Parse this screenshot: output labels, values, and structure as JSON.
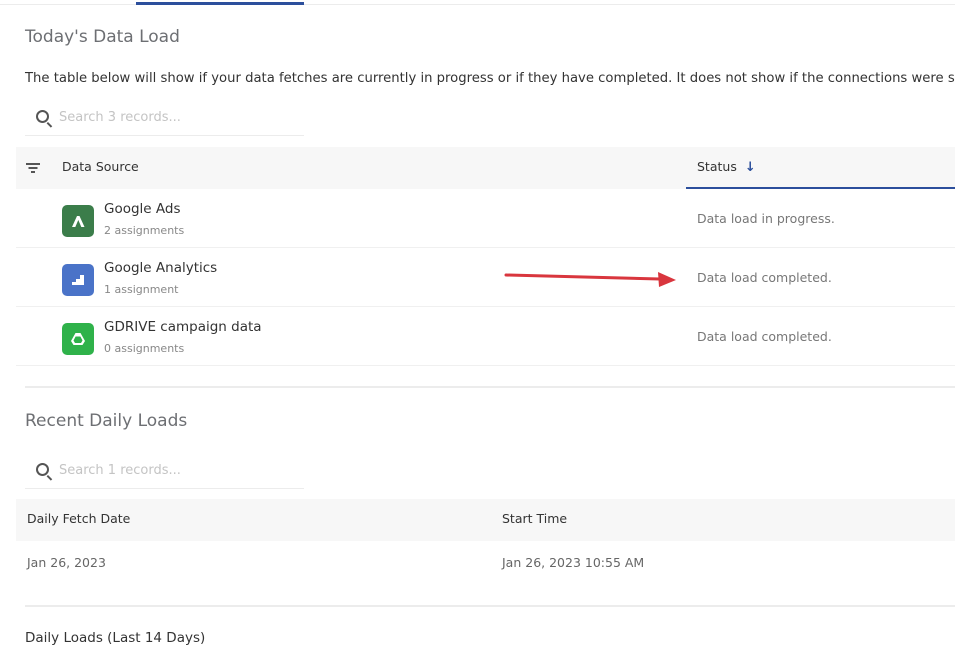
{
  "today": {
    "title": "Today's Data Load",
    "description": "The table below will show if your data fetches are currently in progress or if they have completed. It does not show if the connections were succe",
    "search_placeholder": "Search 3 records...",
    "columns": {
      "source": "Data Source",
      "status": "Status"
    },
    "rows": [
      {
        "name": "Google Ads",
        "sub": "2 assignments",
        "status": "Data load in progress.",
        "icon": "google-ads-icon",
        "color": "#3b7d4a"
      },
      {
        "name": "Google Analytics",
        "sub": "1 assignment",
        "status": "Data load completed.",
        "icon": "google-analytics-icon",
        "color": "#4a73c8"
      },
      {
        "name": "GDRIVE campaign data",
        "sub": "0 assignments",
        "status": "Data load completed.",
        "icon": "google-drive-icon",
        "color": "#2fb24a"
      }
    ]
  },
  "recent": {
    "title": "Recent Daily Loads",
    "search_placeholder": "Search 1 records...",
    "columns": {
      "date": "Daily Fetch Date",
      "start": "Start Time"
    },
    "rows": [
      {
        "date": "Jan 26, 2023",
        "start": "Jan 26, 2023 10:55 AM"
      }
    ]
  },
  "daily": {
    "title": "Daily Loads (Last 14 Days)"
  },
  "colors": {
    "accent": "#2c4f9c",
    "annotation": "#d9363e"
  }
}
